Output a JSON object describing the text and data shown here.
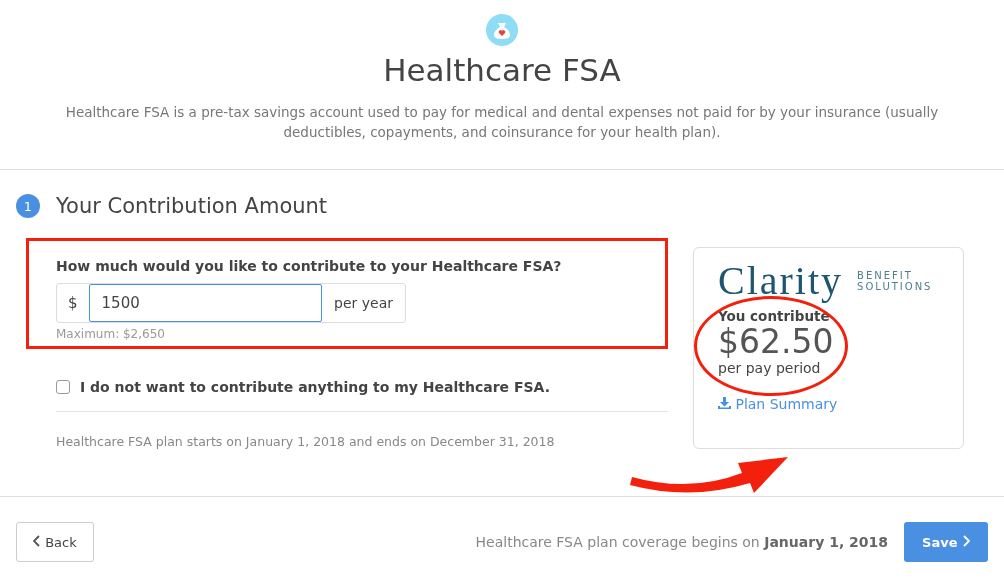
{
  "header": {
    "title": "Healthcare FSA",
    "description": "Healthcare FSA is a pre-tax savings account used to pay for medical and dental expenses not paid for by your insurance (usually deductibles, copayments, and coinsurance for your health plan)."
  },
  "section": {
    "step": "1",
    "title": "Your Contribution Amount",
    "question": "How much would you like to contribute to your Healthcare FSA?",
    "prefix": "$",
    "amount": "1500",
    "suffix": "per year",
    "maximum": "Maximum: $2,650",
    "opt_out": {
      "label": "I do not want to contribute anything to my Healthcare FSA.",
      "checked": false
    },
    "plan_dates": "Healthcare FSA plan starts on January 1, 2018 and ends on December 31, 2018"
  },
  "summary": {
    "logo_name": "Clarity",
    "logo_tag_1": "BENEFIT",
    "logo_tag_2": "SOLUTIONS",
    "label": "You contribute",
    "amount": "$62.50",
    "period": "per pay period",
    "link": "Plan Summary"
  },
  "footer": {
    "back": "Back",
    "coverage": "Healthcare FSA plan coverage begins on **January 1, 2018**",
    "save": "Save"
  }
}
